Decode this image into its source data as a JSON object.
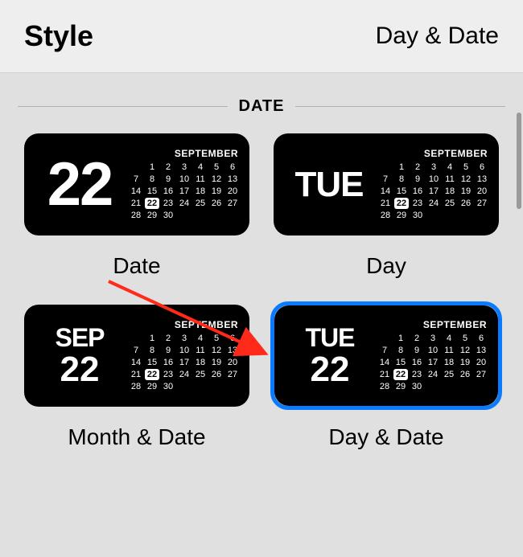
{
  "header": {
    "title": "Style",
    "selected": "Day & Date"
  },
  "section_label": "DATE",
  "calendar": {
    "month_label": "SEPTEMBER",
    "today": 22,
    "start_offset": 1,
    "days": 30
  },
  "options": [
    {
      "id": "date",
      "label": "Date",
      "left_type": "num",
      "line1": "22",
      "line2": "",
      "selected": false
    },
    {
      "id": "day",
      "label": "Day",
      "left_type": "day",
      "line1": "TUE",
      "line2": "",
      "selected": false
    },
    {
      "id": "month-date",
      "label": "Month & Date",
      "left_type": "stack",
      "line1": "SEP",
      "line2": "22",
      "selected": false
    },
    {
      "id": "day-date",
      "label": "Day & Date",
      "left_type": "stack",
      "line1": "TUE",
      "line2": "22",
      "selected": true
    }
  ],
  "arrow_color": "#ff2a1a"
}
